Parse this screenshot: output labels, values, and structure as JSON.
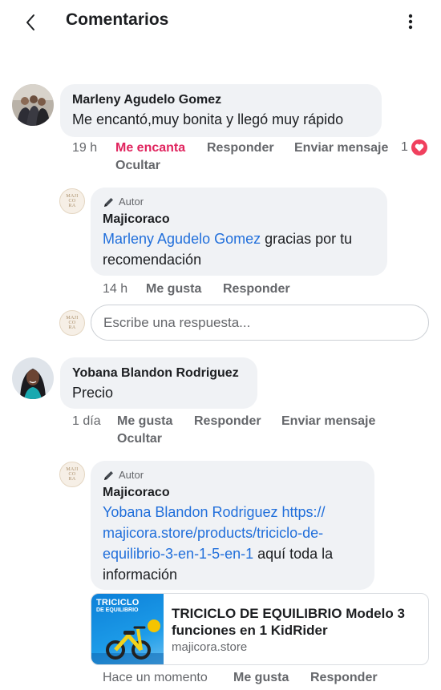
{
  "header": {
    "title": "Comentarios"
  },
  "comments": [
    {
      "author": "Marleny Agudelo Gomez",
      "text": "Me encantó,muy bonita y llegó muy rápido",
      "time": "19 h",
      "reaction_label": "Me encanta",
      "reply_label": "Responder",
      "message_label": "Enviar mensaje",
      "hide_label": "Ocultar",
      "reaction_count": "1",
      "reply": {
        "badge": "Autor",
        "author": "Majicoraco",
        "mention": "Marleny Agudelo Gomez",
        "text": " gracias por tu recomendación",
        "time": "14 h",
        "like_label": "Me gusta",
        "reply_label": "Responder"
      }
    },
    {
      "author": "Yobana Blandon Rodriguez",
      "text": "Precio",
      "time": "1 día",
      "like_label": "Me gusta",
      "reply_label": "Responder",
      "message_label": "Enviar mensaje",
      "hide_label": "Ocultar",
      "reply": {
        "badge": "Autor",
        "author": "Majicoraco",
        "mention": "Yobana Blandon Rodriguez",
        "url": "https://majicora.store/products/triciclo-de-equilibrio-3-en-1-5-en-1",
        "url_line1": "https://",
        "url_line2": "majicora.store/products/triciclo-de-",
        "url_line3": "equilibrio-3-en-1-5-en-1",
        "text": " aquí toda la información",
        "time": "Hace un momento",
        "like_label": "Me gusta",
        "reply_label": "Responder"
      }
    }
  ],
  "reply_box": {
    "placeholder": "Escribe una respuesta..."
  },
  "link_preview": {
    "thumb_title": "TRICICLO",
    "thumb_subtitle": "DE EQUILIBRIO",
    "title": "TRICICLO DE EQUILIBRIO Modelo 3 funciones en 1 KidRider",
    "domain": "majicora.store"
  },
  "logo_text": [
    "MAJI",
    "CO",
    "RA"
  ],
  "colors": {
    "link": "#216fdb",
    "love": "#e0245e",
    "secondary": "#65676b",
    "bubble": "#f0f2f5"
  },
  "icons": [
    "back-arrow-icon",
    "more-vertical-icon",
    "pencil-icon",
    "heart-icon"
  ]
}
